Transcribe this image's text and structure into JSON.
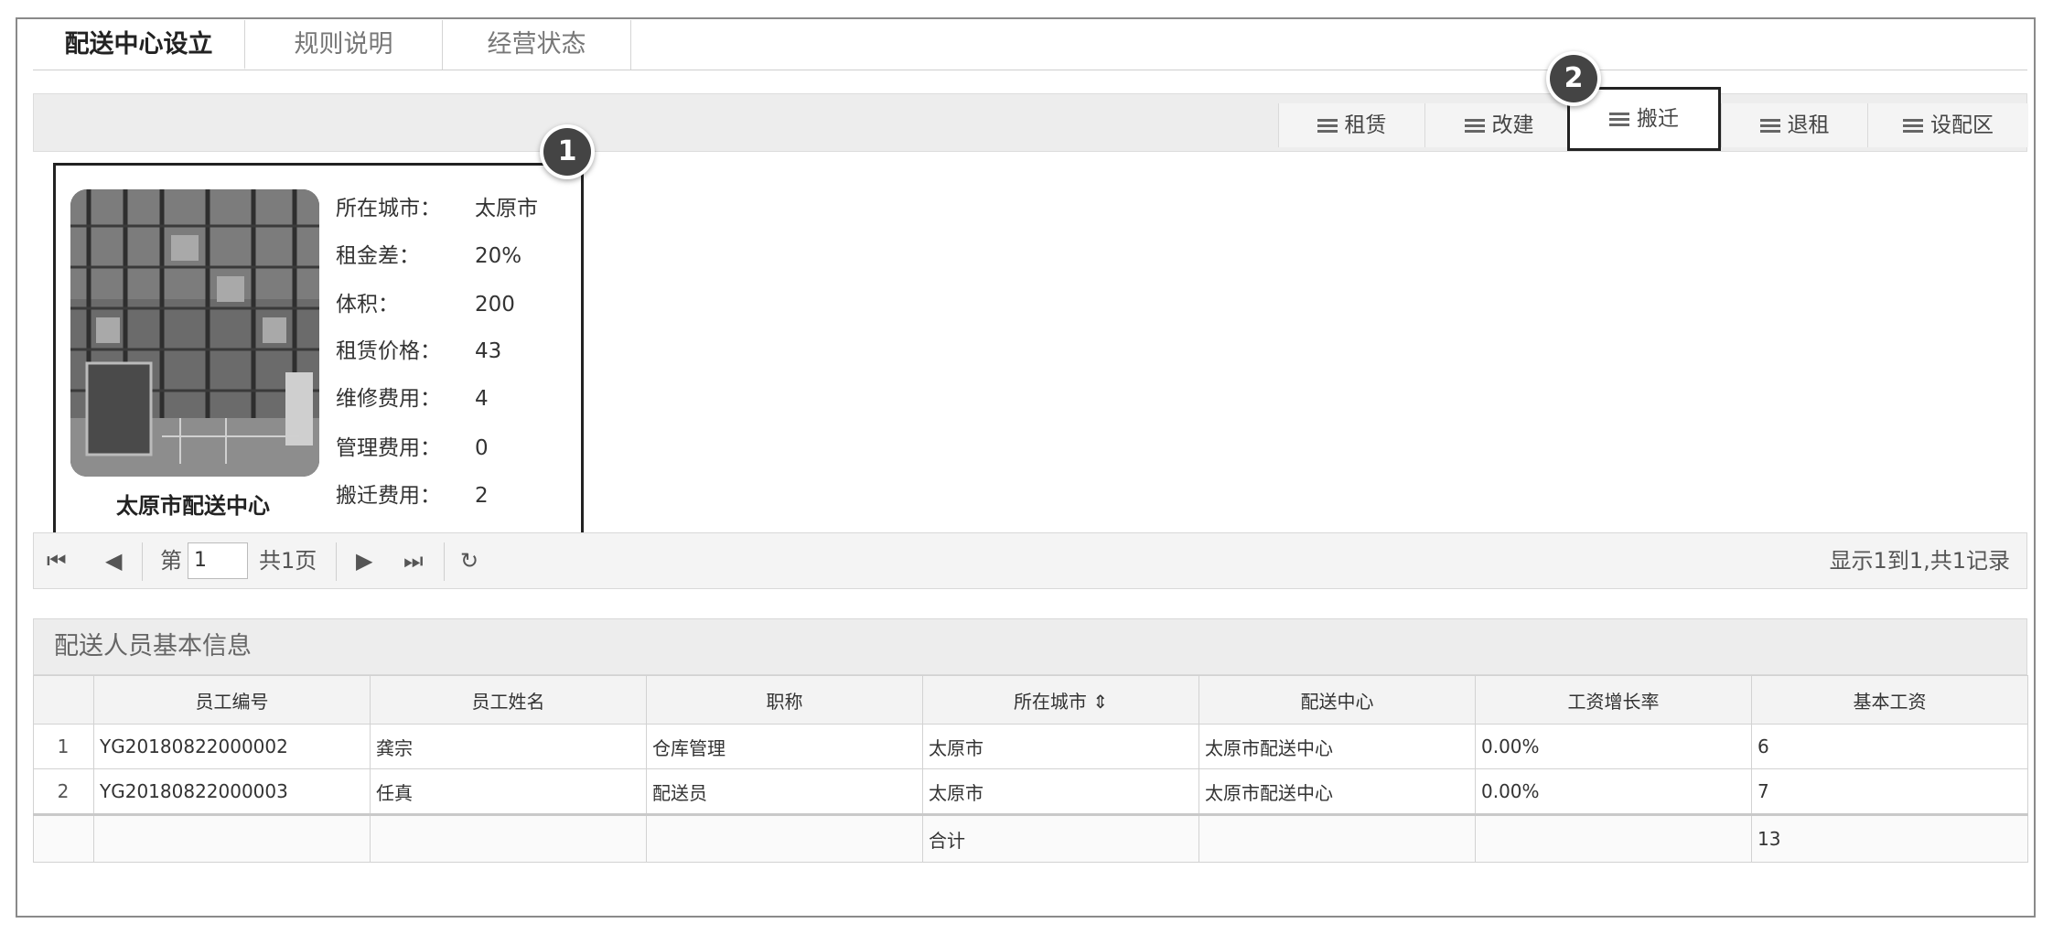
{
  "tabs": [
    {
      "label": "配送中心设立",
      "active": true
    },
    {
      "label": "规则说明",
      "active": false
    },
    {
      "label": "经营状态",
      "active": false
    }
  ],
  "toolbar": {
    "buttons": [
      {
        "label": "租赁",
        "icon": "list-icon"
      },
      {
        "label": "改建",
        "icon": "list-icon"
      },
      {
        "label": "搬迁",
        "icon": "list-icon",
        "highlighted": true
      },
      {
        "label": "退租",
        "icon": "list-icon"
      },
      {
        "label": "设配区",
        "icon": "list-icon"
      }
    ]
  },
  "badges": {
    "one": "1",
    "two": "2"
  },
  "center_card": {
    "title": "太原市配送中心",
    "fields": [
      {
        "label": "所在城市：",
        "value": "太原市"
      },
      {
        "label": "租金差：",
        "value": "20%"
      },
      {
        "label": "体积：",
        "value": "200"
      },
      {
        "label": "租赁价格：",
        "value": "43"
      },
      {
        "label": "维修费用：",
        "value": "4"
      },
      {
        "label": "管理费用：",
        "value": "0"
      },
      {
        "label": "搬迁费用：",
        "value": "2"
      }
    ]
  },
  "pager": {
    "page_prefix": "第",
    "page_value": "1",
    "page_total": "共1页",
    "summary": "显示1到1,共1记录"
  },
  "staff_panel": {
    "title": "配送人员基本信息",
    "columns": [
      "员工编号",
      "员工姓名",
      "职称",
      "所在城市 ⇕",
      "配送中心",
      "工资增长率",
      "基本工资"
    ],
    "rows": [
      {
        "no": "1",
        "cells": [
          "YG20180822000002",
          "龚宗",
          "仓库管理",
          "太原市",
          "太原市配送中心",
          "0.00%",
          "6"
        ]
      },
      {
        "no": "2",
        "cells": [
          "YG20180822000003",
          "任真",
          "配送员",
          "太原市",
          "太原市配送中心",
          "0.00%",
          "7"
        ]
      }
    ],
    "total_label": "合计",
    "total_value": "13"
  }
}
